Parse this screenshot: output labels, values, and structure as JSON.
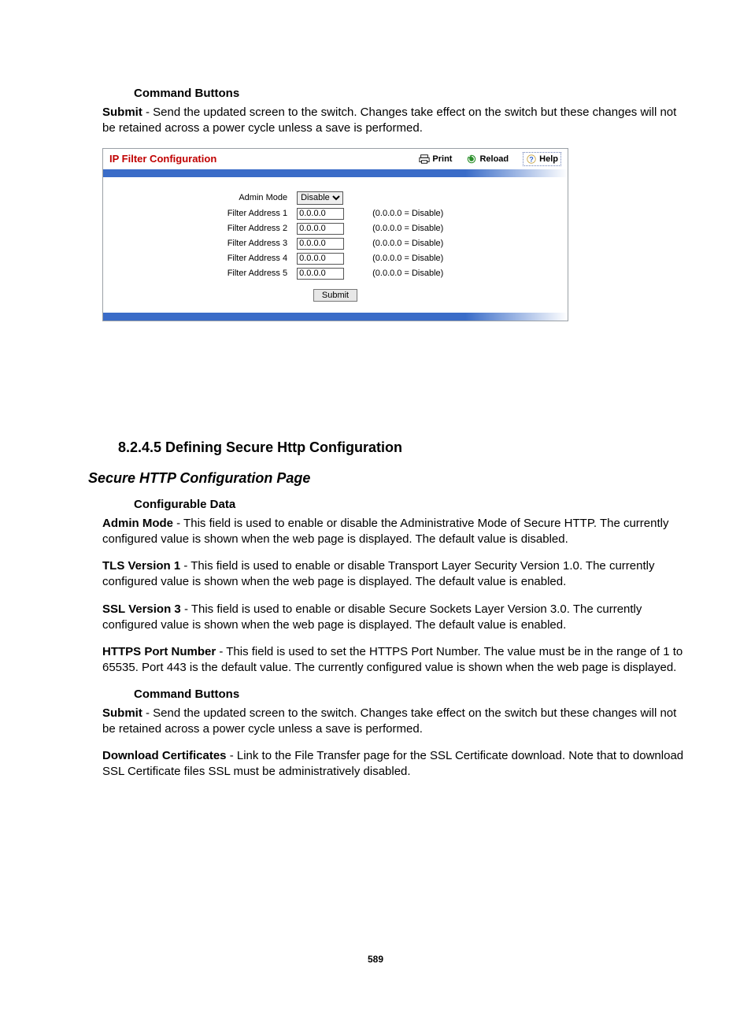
{
  "doc": {
    "cmd_heading_top": "Command Buttons",
    "submit_para_term": "Submit",
    "submit_para_text": " - Send the updated screen to the switch. Changes take effect on the switch but these changes will not be retained across a power cycle unless a save is performed.",
    "section_num_title": "8.2.4.5 Defining Secure Http Configuration",
    "section_italic": "Secure HTTP Configuration Page",
    "config_data_heading": "Configurable Data",
    "paras": [
      {
        "term": "Admin Mode",
        "text": " - This field is used to enable or disable the Administrative Mode of Secure HTTP. The currently configured value is shown when the web page is displayed. The default value is disabled."
      },
      {
        "term": "TLS Version 1",
        "text": " - This field is used to enable or disable Transport Layer Security Version 1.0. The currently configured value is shown when the web page is displayed. The default value is enabled."
      },
      {
        "term": "SSL Version 3",
        "text": " - This field is used to enable or disable Secure Sockets Layer Version 3.0. The currently configured value is shown when the web page is displayed. The default value is enabled."
      },
      {
        "term": "HTTPS Port Number",
        "text": " - This field is used to set the HTTPS Port Number. The value must be in the range of 1 to 65535. Port 443 is the default value. The currently configured value is shown when the web page is displayed."
      }
    ],
    "cmd_heading_bottom": "Command Buttons",
    "submit_para2_term": "Submit",
    "submit_para2_text": " - Send the updated screen to the switch. Changes take effect on the switch but these changes will not be retained across a power cycle unless a save is performed.",
    "dlcert_term": "Download Certificates",
    "dlcert_text": " - Link to the File Transfer page for the SSL Certificate download. Note that to download SSL Certificate files SSL must be administratively disabled.",
    "page_number": "589"
  },
  "panel": {
    "title": "IP Filter Configuration",
    "actions": {
      "print": "Print",
      "reload": "Reload",
      "help": "Help"
    },
    "admin_mode_label": "Admin Mode",
    "admin_mode_value": "Disable",
    "rows": [
      {
        "label": "Filter Address 1",
        "value": "0.0.0.0",
        "hint": "(0.0.0.0 = Disable)"
      },
      {
        "label": "Filter Address 2",
        "value": "0.0.0.0",
        "hint": "(0.0.0.0 = Disable)"
      },
      {
        "label": "Filter Address 3",
        "value": "0.0.0.0",
        "hint": "(0.0.0.0 = Disable)"
      },
      {
        "label": "Filter Address 4",
        "value": "0.0.0.0",
        "hint": "(0.0.0.0 = Disable)"
      },
      {
        "label": "Filter Address 5",
        "value": "0.0.0.0",
        "hint": "(0.0.0.0 = Disable)"
      }
    ],
    "submit_label": "Submit"
  }
}
